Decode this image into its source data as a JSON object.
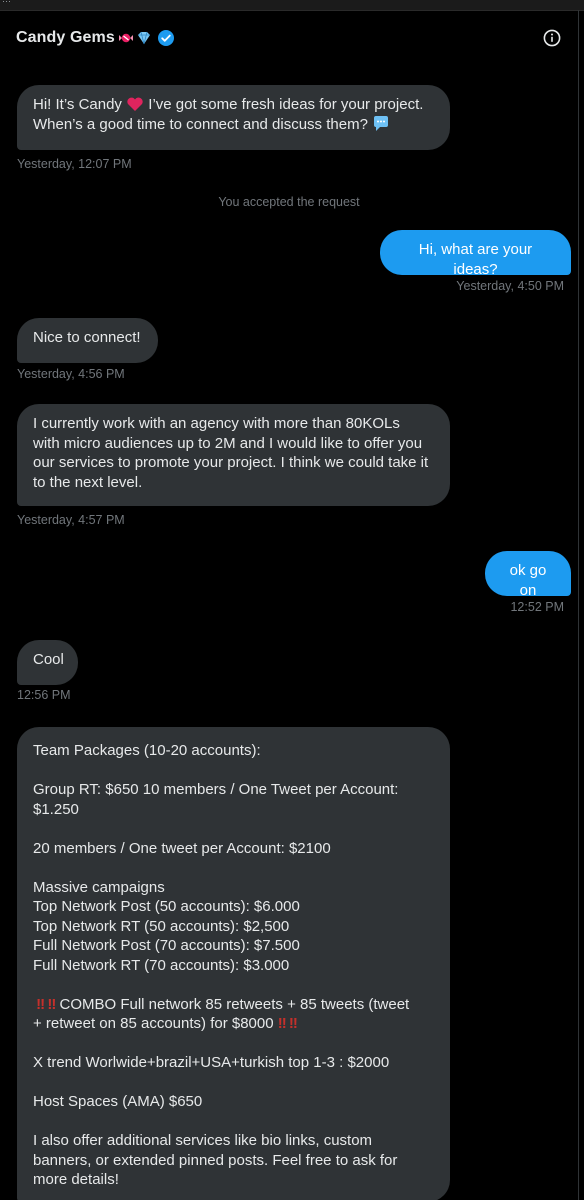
{
  "header": {
    "title": "Candy Gems",
    "icons": [
      "candy-icon",
      "gem-icon",
      "verified-badge-icon",
      "info-icon"
    ]
  },
  "colors": {
    "background": "#000000",
    "incoming_bubble": "#2f3336",
    "outgoing_bubble": "#1d9bf0",
    "timestamp": "#71767b",
    "verified": "#1d9bf0"
  },
  "messages": [
    {
      "id": "m1",
      "direction": "in",
      "lines": [
        "Hi! It’s Candy",
        "I’ve got some fresh ideas for your project.",
        "When’s a good time to connect and discuss them?"
      ],
      "time": "Yesterday, 12:07 PM"
    },
    {
      "id": "sys1",
      "system": "You accepted the request"
    },
    {
      "id": "m2",
      "direction": "out",
      "text": "Hi, what are your ideas?",
      "time": "Yesterday, 4:50 PM"
    },
    {
      "id": "m3",
      "direction": "in",
      "text": "Nice to connect!",
      "time": "Yesterday, 4:56 PM"
    },
    {
      "id": "m4",
      "direction": "in",
      "lines": [
        "I currently work with an agency with more than 80KOLs",
        "with micro audiences up to 2M and I would like to offer you",
        "our services to promote your project. I think we could take it",
        "to the next level."
      ],
      "time": "Yesterday, 4:57 PM"
    },
    {
      "id": "m5",
      "direction": "out",
      "text": "ok go on",
      "time": "12:52 PM"
    },
    {
      "id": "m6",
      "direction": "in",
      "text": "Cool",
      "time": "12:56 PM"
    },
    {
      "id": "m7",
      "direction": "in",
      "lines": [
        "Team Packages (10-20 accounts):",
        "",
        "Group RT: $650 10 members / One Tweet per Account:",
        "$1.250",
        "",
        "20 members / One tweet per Account: $2100",
        "",
        "Massive campaigns",
        "Top Network Post (50 accounts): $6.000",
        "Top Network RT (50 accounts): $2,500",
        "Full Network Post (70 accounts): $7.500",
        "Full Network RT (70 accounts): $3.000",
        "",
        "COMBO Full network 85 retweets + 85 tweets (tweet",
        "+ retweet on 85 accounts) for $8000",
        "",
        "X trend Worlwide+brazil+USA+turkish top 1-3 : $2000",
        "",
        "Host Spaces (AMA) $650",
        "",
        "I also offer additional services like bio links, custom",
        "banners, or extended pinned posts. Feel free to ask for",
        "more details!"
      ]
    }
  ]
}
